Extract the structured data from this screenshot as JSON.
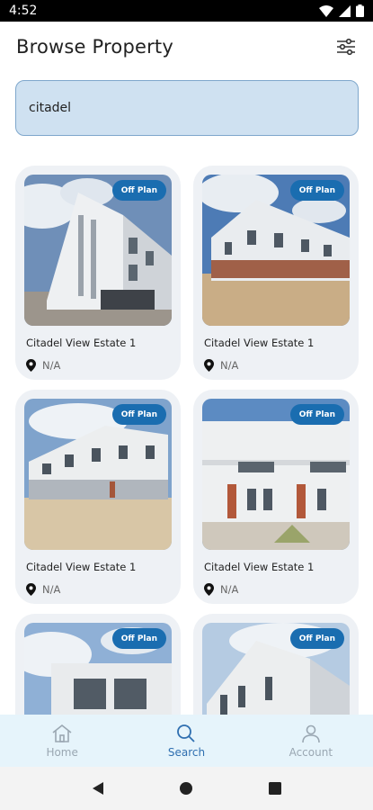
{
  "status_bar": {
    "time": "4:52"
  },
  "header": {
    "title": "Browse Property"
  },
  "search": {
    "value": "citadel"
  },
  "colors": {
    "accent": "#1a6db0",
    "search_bg": "#cfe1f1",
    "nav_bg": "#e6f4fb",
    "active_tab": "#2f6fb0"
  },
  "listings": [
    {
      "badge": "Off Plan",
      "title": "Citadel View Estate 1",
      "location": "N/A"
    },
    {
      "badge": "Off Plan",
      "title": "Citadel View Estate 1",
      "location": "N/A"
    },
    {
      "badge": "Off Plan",
      "title": "Citadel View Estate 1",
      "location": "N/A"
    },
    {
      "badge": "Off Plan",
      "title": "Citadel View Estate 1",
      "location": "N/A"
    },
    {
      "badge": "Off Plan",
      "title": "",
      "location": ""
    },
    {
      "badge": "Off Plan",
      "title": "",
      "location": ""
    }
  ],
  "bottom_nav": [
    {
      "label": "Home",
      "icon": "home-icon"
    },
    {
      "label": "Search",
      "icon": "search-icon",
      "active": true
    },
    {
      "label": "Account",
      "icon": "account-icon"
    }
  ]
}
